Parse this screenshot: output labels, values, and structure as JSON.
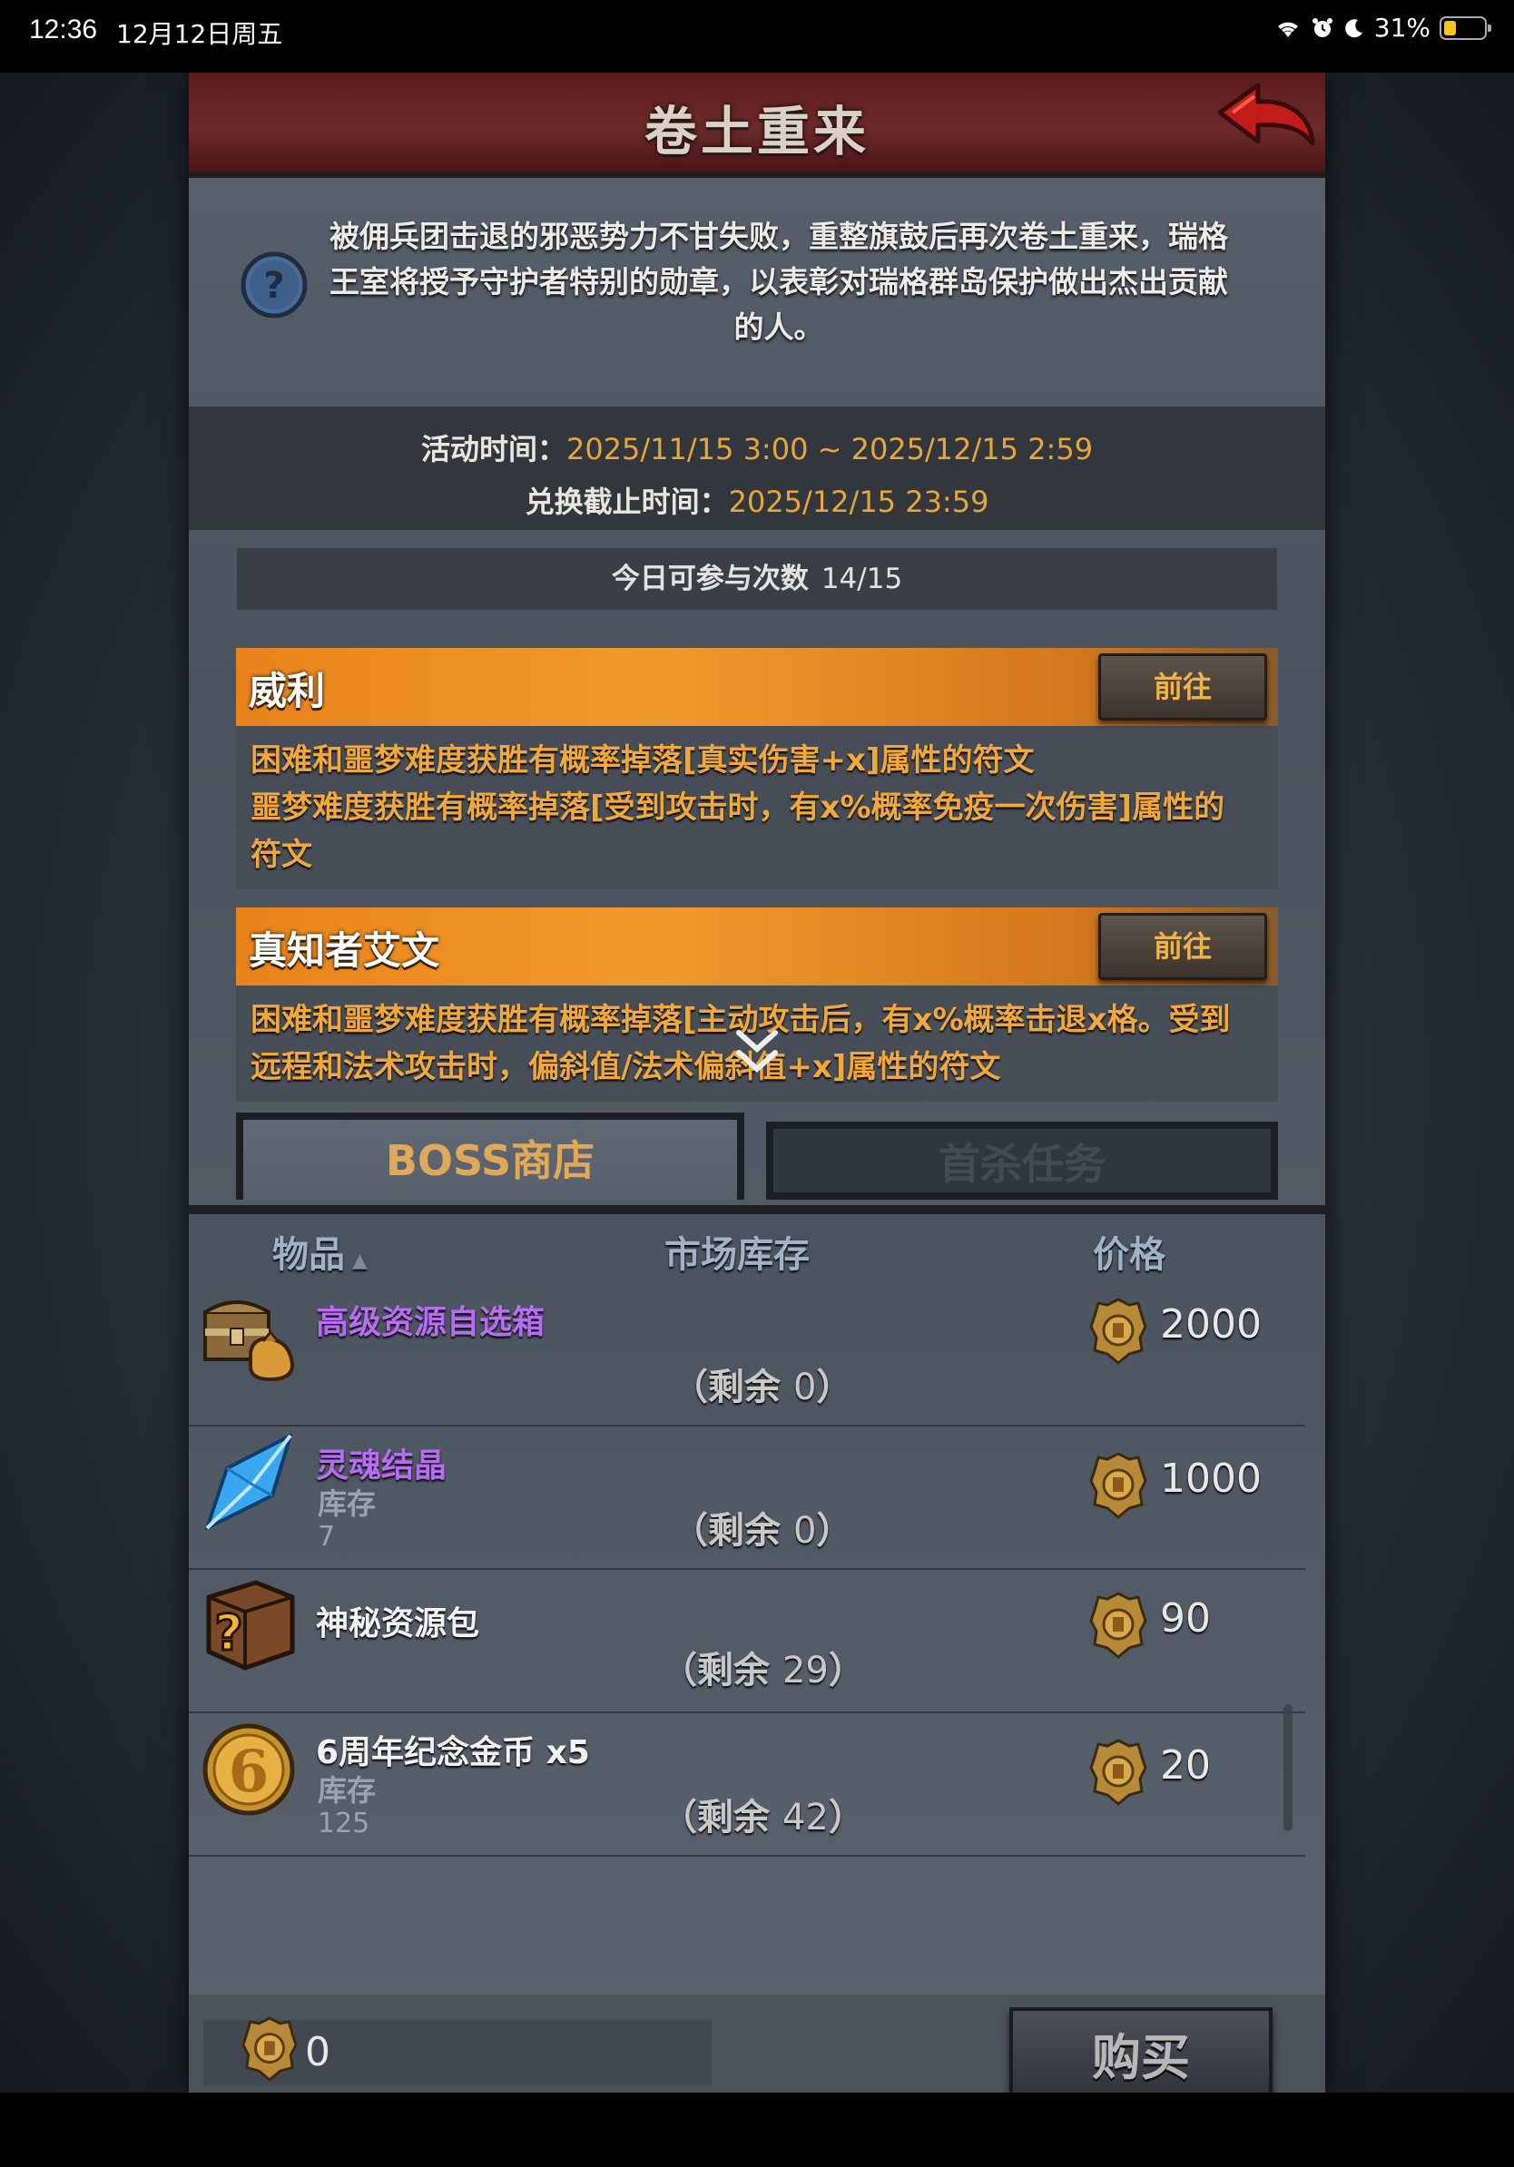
{
  "status_bar": {
    "time": "12:36",
    "date": "12月12日周五",
    "battery": "31%",
    "battery_level": 0.31
  },
  "header": {
    "title": "卷土重来"
  },
  "intro": {
    "text": "被佣兵团击退的邪恶势力不甘失败，重整旗鼓后再次卷土重来，瑞格王室将授予守护者特别的勋章，以表彰对瑞格群岛保护做出杰出贡献的人。"
  },
  "event": {
    "activity_label": "活动时间：",
    "activity_value": "2025/11/15 3:00 ~ 2025/12/15 2:59",
    "exchange_label": "兑换截止时间：",
    "exchange_value": "2025/12/15 23:59"
  },
  "daily": {
    "label": "今日可参与次数",
    "value": "14/15"
  },
  "bosses": [
    {
      "name": "威利",
      "button": "前往",
      "desc_lines": [
        "困难和噩梦难度获胜有概率掉落[真实伤害+x]属性的符文",
        "噩梦难度获胜有概率掉落[受到攻击时，有x%概率免疫一次伤害]属性的",
        "符文"
      ]
    },
    {
      "name": "真知者艾文",
      "button": "前往",
      "desc_lines": [
        "困难和噩梦难度获胜有概率掉落[主动攻击后，有x%概率击退x格。受到",
        "远程和法术攻击时，偏斜值/法术偏斜值+x]属性的符文"
      ]
    }
  ],
  "tabs": {
    "shop": "BOSS商店",
    "first_kill": "首杀任务"
  },
  "columns": {
    "item": "物品",
    "sort_marker": "▲",
    "stock": "市场库存",
    "price": "价格"
  },
  "items": [
    {
      "name": "高级资源自选箱",
      "stock_label": "",
      "stock_value": "",
      "remain_prefix": "（剩余",
      "remain": "0",
      "remain_suffix": "）",
      "price": "2000",
      "icon": "treasure-chest-icon"
    },
    {
      "name": "灵魂结晶",
      "stock_label": "库存",
      "stock_value": "7",
      "remain_prefix": "（剩余",
      "remain": "0",
      "remain_suffix": "）",
      "price": "1000",
      "icon": "soul-crystal-icon"
    },
    {
      "name": "神秘资源包",
      "stock_label": "",
      "stock_value": "",
      "remain_prefix": "（剩余",
      "remain": "29",
      "remain_suffix": "）",
      "price": "90",
      "icon": "mystery-crate-icon"
    },
    {
      "name": "6周年纪念金币 x5",
      "stock_label": "库存",
      "stock_value": "125",
      "remain_prefix": "（剩余",
      "remain": "42",
      "remain_suffix": "）",
      "price": "20",
      "icon": "anniversary-coin-icon"
    }
  ],
  "wallet": {
    "value": "0"
  },
  "buy_button": "购买",
  "colors": {
    "accent_orange": "#f19a2c",
    "rarity_purple": "#b76cf2",
    "header_red": "#6d2a2b",
    "time_orange": "#e8a63a"
  }
}
